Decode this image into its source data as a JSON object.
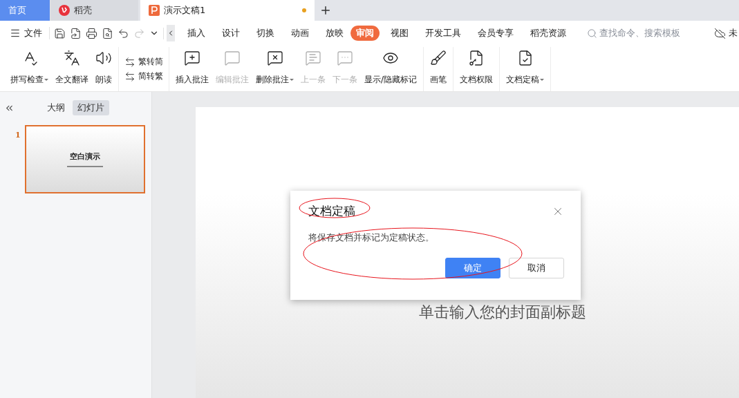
{
  "tabs": [
    {
      "label": "首页",
      "kind": "home",
      "selected": false
    },
    {
      "label": "稻壳",
      "kind": "docer",
      "selected": false
    },
    {
      "label": "演示文稿1",
      "kind": "doc",
      "selected": true,
      "unsaved": true
    }
  ],
  "menu": {
    "file": "文件",
    "items": [
      {
        "label": "插入",
        "selected": false
      },
      {
        "label": "设计",
        "selected": false
      },
      {
        "label": "切换",
        "selected": false
      },
      {
        "label": "动画",
        "selected": false
      },
      {
        "label": "放映",
        "selected": false
      },
      {
        "label": "审阅",
        "selected": true
      },
      {
        "label": "视图",
        "selected": false
      },
      {
        "label": "开发工具",
        "selected": false
      },
      {
        "label": "会员专享",
        "selected": false
      },
      {
        "label": "稻壳资源",
        "selected": false
      }
    ],
    "search": {
      "placeholder": "查找命令、搜索模板"
    },
    "cloud_label": "未"
  },
  "ribbon": [
    [
      {
        "label": "拼写检查",
        "kind": "large",
        "disabled": false,
        "dropdown": true
      },
      {
        "label": "全文翻译",
        "kind": "large",
        "disabled": false,
        "dropdown": false
      },
      {
        "label": "朗读",
        "kind": "large",
        "disabled": false,
        "dropdown": false
      }
    ],
    [
      {
        "label": "繁转简",
        "kind": "small",
        "disabled": false
      },
      {
        "label": "简转繁",
        "kind": "small",
        "disabled": false
      }
    ],
    [
      {
        "label": "插入批注",
        "kind": "large",
        "disabled": false,
        "dropdown": false
      },
      {
        "label": "编辑批注",
        "kind": "large",
        "disabled": true,
        "dropdown": false
      },
      {
        "label": "删除批注",
        "kind": "large",
        "disabled": false,
        "dropdown": true
      },
      {
        "label": "上一条",
        "kind": "large",
        "disabled": true,
        "dropdown": false
      },
      {
        "label": "下一条",
        "kind": "large",
        "disabled": true,
        "dropdown": false
      },
      {
        "label": "显示/隐藏标记",
        "kind": "large",
        "disabled": false,
        "dropdown": false
      }
    ],
    [
      {
        "label": "画笔",
        "kind": "large",
        "disabled": false,
        "dropdown": false
      }
    ],
    [
      {
        "label": "文档权限",
        "kind": "large",
        "disabled": false,
        "dropdown": false
      }
    ],
    [
      {
        "label": "文档定稿",
        "kind": "large",
        "disabled": false,
        "dropdown": true
      }
    ]
  ],
  "panel": {
    "tabs": [
      {
        "label": "大纲",
        "selected": false
      },
      {
        "label": "幻灯片",
        "selected": true
      }
    ],
    "slides": [
      {
        "number": "1",
        "title": "空白演示",
        "selected": true
      }
    ]
  },
  "slide": {
    "subtitle": "单击输入您的封面副标题"
  },
  "dialog": {
    "title": "文档定稿",
    "message": "将保存文档并标记为定稿状态。",
    "buttons": [
      {
        "label": "确定",
        "primary": true
      },
      {
        "label": "取消",
        "primary": false
      }
    ]
  },
  "annotations": [
    {
      "kind": "ellipse"
    },
    {
      "kind": "ellipse"
    }
  ]
}
